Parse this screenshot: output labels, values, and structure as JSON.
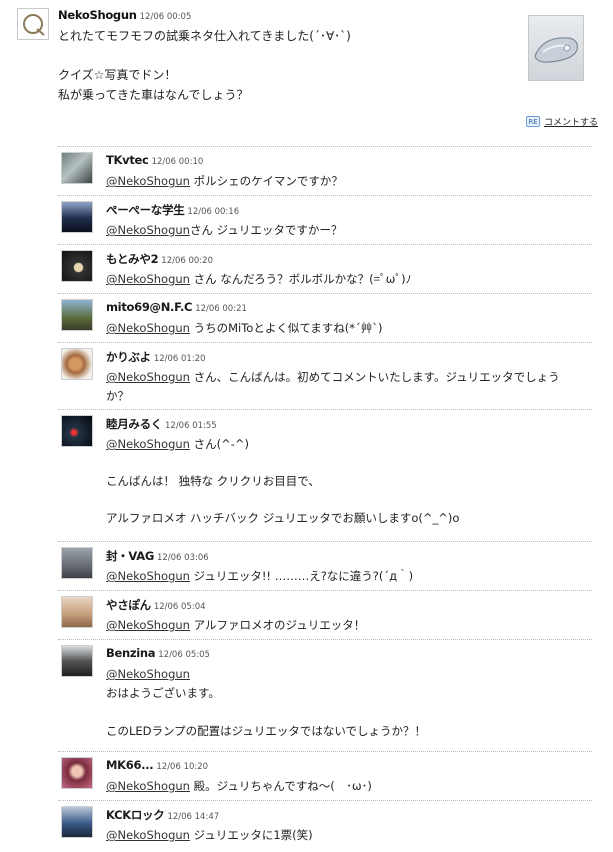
{
  "post": {
    "user": "NekoShogun",
    "time": "12/06 00:05",
    "lines": [
      "とれたてモフモフの試乗ネタ仕入れてきました(´･∀･`)",
      "",
      "クイズ☆写真でドン！",
      "私が乗ってきた車はなんでしょう？"
    ],
    "comment_label": "コメントする",
    "re_label": "RE"
  },
  "replies": [
    {
      "name": "TKvtec",
      "time": "12/06 00:10",
      "mention": "@NekoShogun",
      "lines": [
        " ポルシェのケイマンですか？"
      ]
    },
    {
      "name": "ぺーぺーな学生",
      "time": "12/06 00:16",
      "mention": "@NekoShogun",
      "lines": [
        "さん ジュリエッタですかー？"
      ]
    },
    {
      "name": "もとみや2",
      "time": "12/06 00:20",
      "mention": "@NekoShogun",
      "lines": [
        " さん なんだろう？ボルボルかな？(=ﾟωﾟ)ﾉ"
      ]
    },
    {
      "name": "mito69@N.F.C",
      "time": "12/06 00:21",
      "mention": "@NekoShogun",
      "lines": [
        " うちのMiToとよく似てますね(*´艸`)"
      ]
    },
    {
      "name": "かりぶよ",
      "time": "12/06 01:20",
      "mention": "@NekoShogun",
      "lines": [
        " さん、こんばんは。初めてコメントいたします。ジュリエッタでしょう",
        "か？"
      ]
    },
    {
      "name": "睦月みるく",
      "time": "12/06 01:55",
      "mention": "@NekoShogun",
      "lines": [
        " さん(^-^)",
        "",
        "こんばんは！ 独特な クリクリお目目で、",
        "",
        "アルファロメオ ハッチバック ジュリエッタでお願いしますo(^_^)o"
      ]
    },
    {
      "name": "封・VAG",
      "time": "12/06 03:06",
      "mention": "@NekoShogun",
      "lines": [
        " ジュリエッタ!! ………え?なに違う?(´д｀)"
      ]
    },
    {
      "name": "やさぽん",
      "time": "12/06 05:04",
      "mention": "@NekoShogun",
      "lines": [
        " アルファロメオのジュリエッタ！"
      ]
    },
    {
      "name": "Benzina",
      "time": "12/06 05:05",
      "mention": "@NekoShogun",
      "lines": [
        "",
        "おはようございます。",
        "",
        "このLEDランプの配置はジュリエッタではないでしょうか？！"
      ]
    },
    {
      "name": "MK66...",
      "time": "12/06 10:20",
      "mention": "@NekoShogun",
      "lines": [
        " 殿。ジュリちゃんですね〜(　･ω･)"
      ]
    },
    {
      "name": "KCKロック",
      "time": "12/06 14:47",
      "mention": "@NekoShogun",
      "lines": [
        " ジュリエッタに1票(笑)"
      ]
    }
  ]
}
